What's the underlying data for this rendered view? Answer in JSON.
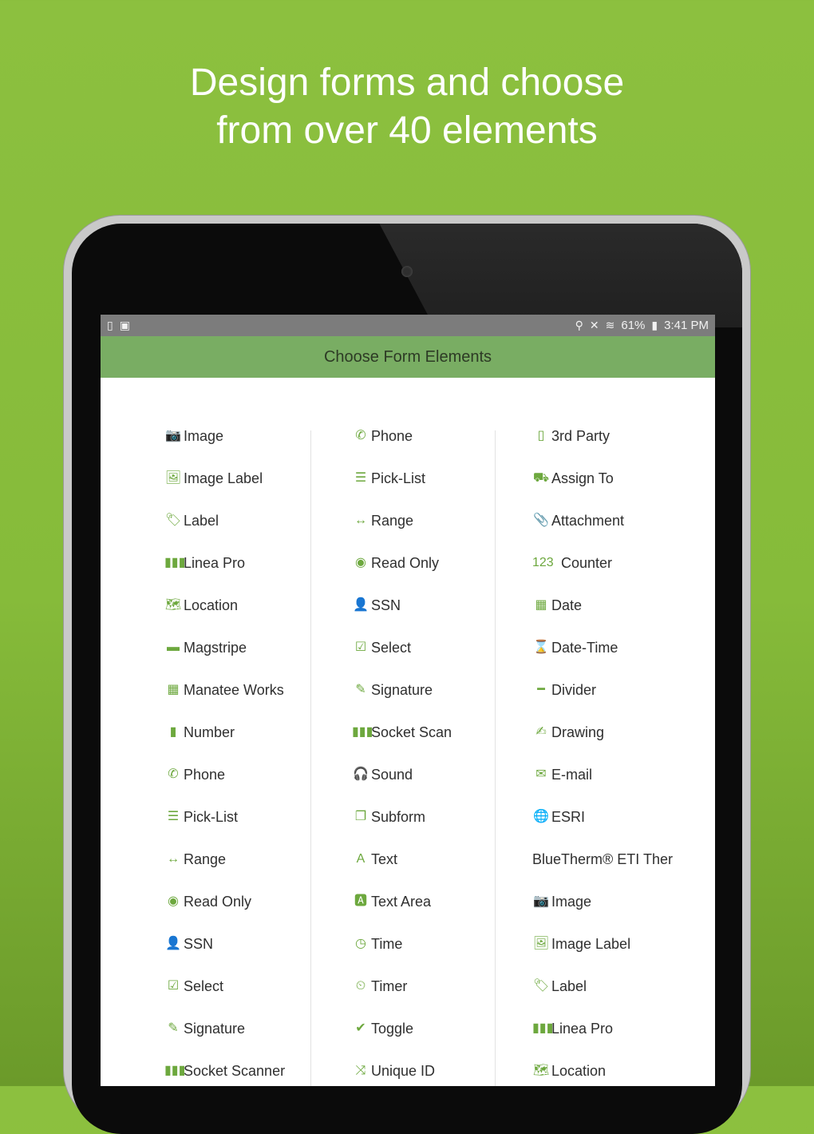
{
  "headline": {
    "line1": "Design forms and choose",
    "line2": "from over 40 elements"
  },
  "status_bar": {
    "battery": "61%",
    "time": "3:41 PM",
    "icons": [
      "sd-card-icon",
      "clipboard-icon",
      "location-icon",
      "mute-icon",
      "wifi-icon",
      "battery-icon"
    ]
  },
  "app_bar": {
    "title": "Choose Form Elements"
  },
  "columns": [
    [
      {
        "icon": "camera-icon",
        "glyph": "📷",
        "label": "Image"
      },
      {
        "icon": "image-icon",
        "glyph": "🖼",
        "label": "Image Label"
      },
      {
        "icon": "tag-icon",
        "glyph": "🏷",
        "label": "Label"
      },
      {
        "icon": "barcode-icon",
        "glyph": "▮▮▮",
        "label": "Linea Pro"
      },
      {
        "icon": "map-icon",
        "glyph": "🗺",
        "label": "Location"
      },
      {
        "icon": "credit-card-icon",
        "glyph": "▬",
        "label": "Magstripe"
      },
      {
        "icon": "qr-code-icon",
        "glyph": "▦",
        "label": "Manatee Works"
      },
      {
        "icon": "bar-chart-icon",
        "glyph": "▮",
        "label": "Number"
      },
      {
        "icon": "phone-icon",
        "glyph": "✆",
        "label": "Phone"
      },
      {
        "icon": "list-icon",
        "glyph": "☰",
        "label": "Pick-List"
      },
      {
        "icon": "arrows-horizontal-icon",
        "glyph": "↔",
        "label": "Range"
      },
      {
        "icon": "eye-icon",
        "glyph": "◉",
        "label": "Read Only"
      },
      {
        "icon": "user-icon",
        "glyph": "👤",
        "label": "SSN"
      },
      {
        "icon": "checkbox-icon",
        "glyph": "☑",
        "label": "Select"
      },
      {
        "icon": "pen-icon",
        "glyph": "✎",
        "label": "Signature"
      },
      {
        "icon": "barcode-icon",
        "glyph": "▮▮▮",
        "label": "Socket Scanner"
      }
    ],
    [
      {
        "icon": "phone-icon",
        "glyph": "✆",
        "label": "Phone"
      },
      {
        "icon": "list-icon",
        "glyph": "☰",
        "label": "Pick-List"
      },
      {
        "icon": "arrows-horizontal-icon",
        "glyph": "↔",
        "label": "Range"
      },
      {
        "icon": "eye-icon",
        "glyph": "◉",
        "label": "Read Only"
      },
      {
        "icon": "user-icon",
        "glyph": "👤",
        "label": "SSN"
      },
      {
        "icon": "checkbox-icon",
        "glyph": "☑",
        "label": "Select"
      },
      {
        "icon": "pen-icon",
        "glyph": "✎",
        "label": "Signature"
      },
      {
        "icon": "barcode-icon",
        "glyph": "▮▮▮",
        "label": "Socket Scan"
      },
      {
        "icon": "headphones-icon",
        "glyph": "🎧",
        "label": "Sound"
      },
      {
        "icon": "files-icon",
        "glyph": "❐",
        "label": "Subform"
      },
      {
        "icon": "font-icon",
        "glyph": "A",
        "label": "Text"
      },
      {
        "icon": "text-area-icon",
        "glyph": "🅰",
        "label": "Text Area"
      },
      {
        "icon": "clock-icon",
        "glyph": "◷",
        "label": "Time"
      },
      {
        "icon": "timer-icon",
        "glyph": "⏲",
        "label": "Timer"
      },
      {
        "icon": "check-icon",
        "glyph": "✔",
        "label": "Toggle"
      },
      {
        "icon": "shuffle-icon",
        "glyph": "⤨",
        "label": "Unique ID"
      }
    ],
    [
      {
        "icon": "mobile-icon",
        "glyph": "▯",
        "label": "3rd Party"
      },
      {
        "icon": "assign-icon",
        "glyph": "⛟",
        "label": "Assign To"
      },
      {
        "icon": "paperclip-icon",
        "glyph": "📎",
        "label": "Attachment"
      },
      {
        "icon": "counter-icon",
        "glyph": "123",
        "label": "Counter"
      },
      {
        "icon": "calendar-icon",
        "glyph": "▦",
        "label": "Date"
      },
      {
        "icon": "hourglass-icon",
        "glyph": "⌛",
        "label": "Date-Time"
      },
      {
        "icon": "minus-icon",
        "glyph": "━",
        "label": "Divider"
      },
      {
        "icon": "edit-icon",
        "glyph": "✍",
        "label": "Drawing"
      },
      {
        "icon": "envelope-icon",
        "glyph": "✉",
        "label": "E-mail"
      },
      {
        "icon": "globe-icon",
        "glyph": "🌐",
        "label": "ESRI"
      },
      {
        "icon": "",
        "glyph": "",
        "label": "BlueTherm® ETI Ther"
      },
      {
        "icon": "camera-icon",
        "glyph": "📷",
        "label": "Image"
      },
      {
        "icon": "image-icon",
        "glyph": "🖼",
        "label": "Image Label"
      },
      {
        "icon": "tag-icon",
        "glyph": "🏷",
        "label": "Label"
      },
      {
        "icon": "barcode-icon",
        "glyph": "▮▮▮",
        "label": "Linea Pro"
      },
      {
        "icon": "map-icon",
        "glyph": "🗺",
        "label": "Location"
      }
    ]
  ]
}
